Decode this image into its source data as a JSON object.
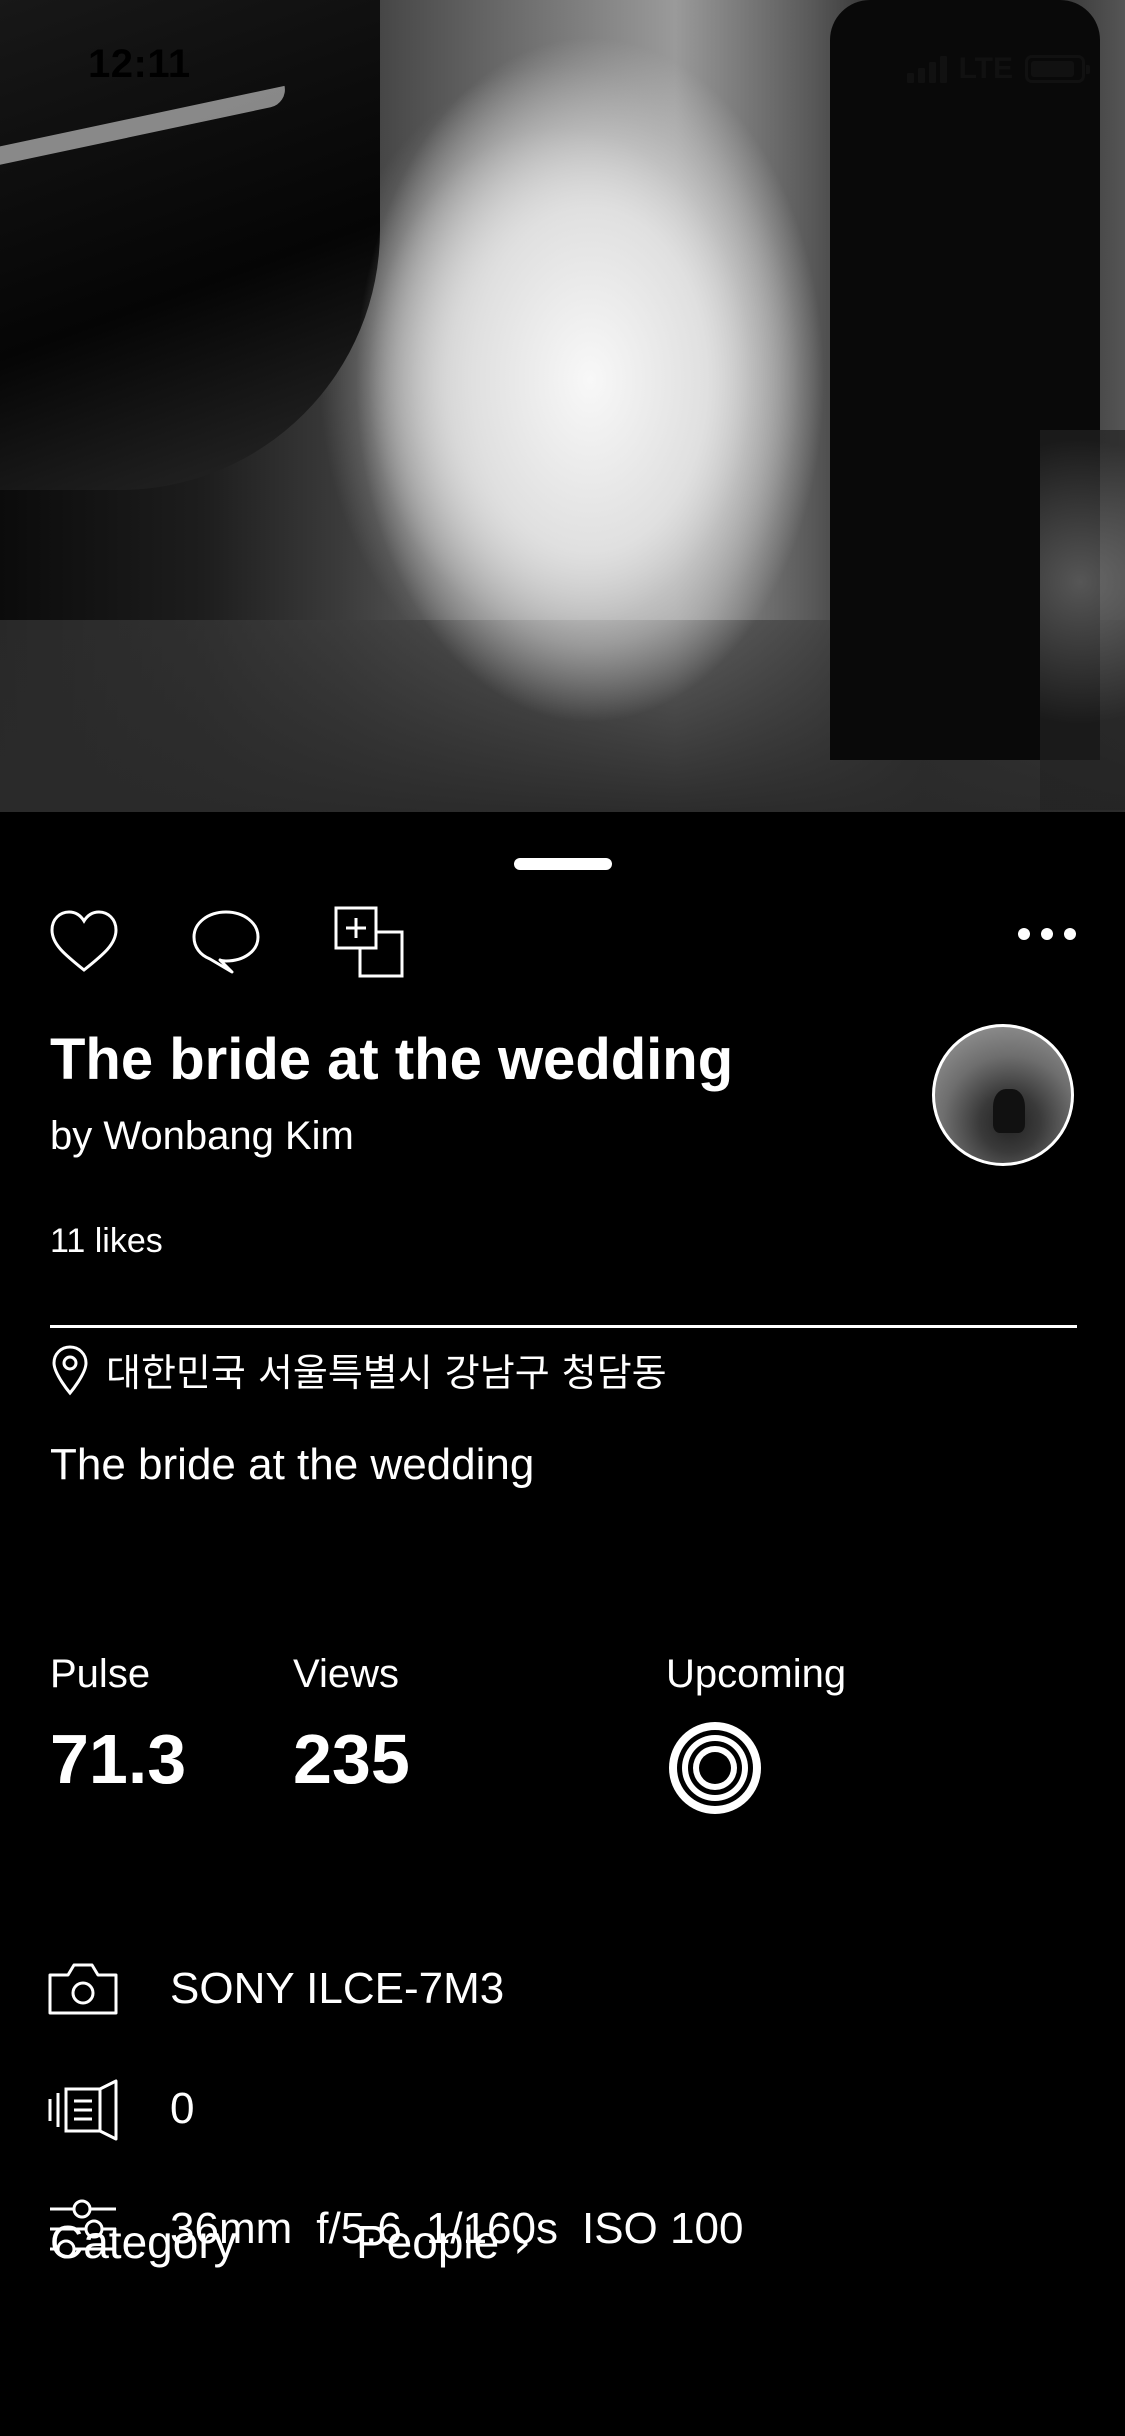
{
  "status_bar": {
    "time": "12:11",
    "network": "LTE"
  },
  "photo": {
    "alt_icon": "wedding-photo"
  },
  "actions": {
    "like_icon": "heart-icon",
    "comment_icon": "comment-icon",
    "add_to_gallery_icon": "add-to-gallery-icon",
    "more_icon": "more-icon"
  },
  "photo_info": {
    "title": "The bride at the wedding",
    "byline": "by Wonbang Kim",
    "likes": "11 likes",
    "location": "대한민국 서울특별시 강남구 청담동",
    "description": "The bride at the wedding"
  },
  "stats": {
    "pulse_label": "Pulse",
    "pulse_value": "71.3",
    "views_label": "Views",
    "views_value": "235",
    "upcoming_label": "Upcoming"
  },
  "specs": {
    "camera": "SONY ILCE-7M3",
    "lens": "0",
    "focal_length": "36mm",
    "aperture": "f/5.6",
    "shutter": "1/160s",
    "iso": "ISO 100"
  },
  "category": {
    "label": "Category",
    "value": "People"
  },
  "colors": {
    "background": "#000000",
    "text": "#ffffff"
  }
}
